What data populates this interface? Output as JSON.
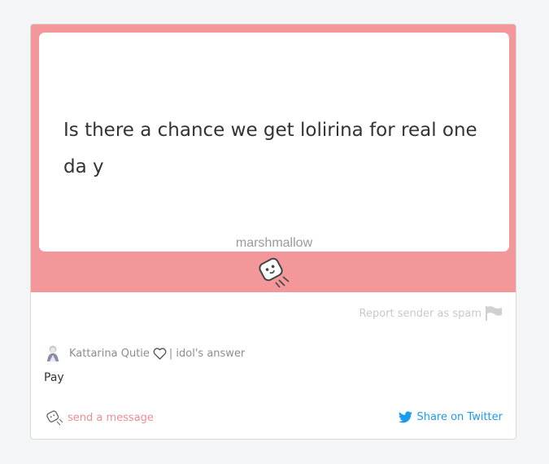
{
  "question": {
    "text": "Is there a chance we get lolirina for real one da y",
    "watermark": "marshmallow"
  },
  "actions": {
    "report_spam": "Report sender as spam",
    "send_message": "send a message",
    "share_twitter": "Share on Twitter"
  },
  "answer": {
    "author": "Kattarina Qutie",
    "label": "| idol's answer",
    "text": "Pay"
  },
  "colors": {
    "accent_pink": "#f4979a",
    "link_pink": "#ec8d93",
    "twitter_blue": "#1d9bf0"
  },
  "icons": [
    "marshmallow-mascot-icon",
    "flag-icon",
    "heart-icon",
    "twitter-bird-icon",
    "marshmallow-small-icon"
  ]
}
